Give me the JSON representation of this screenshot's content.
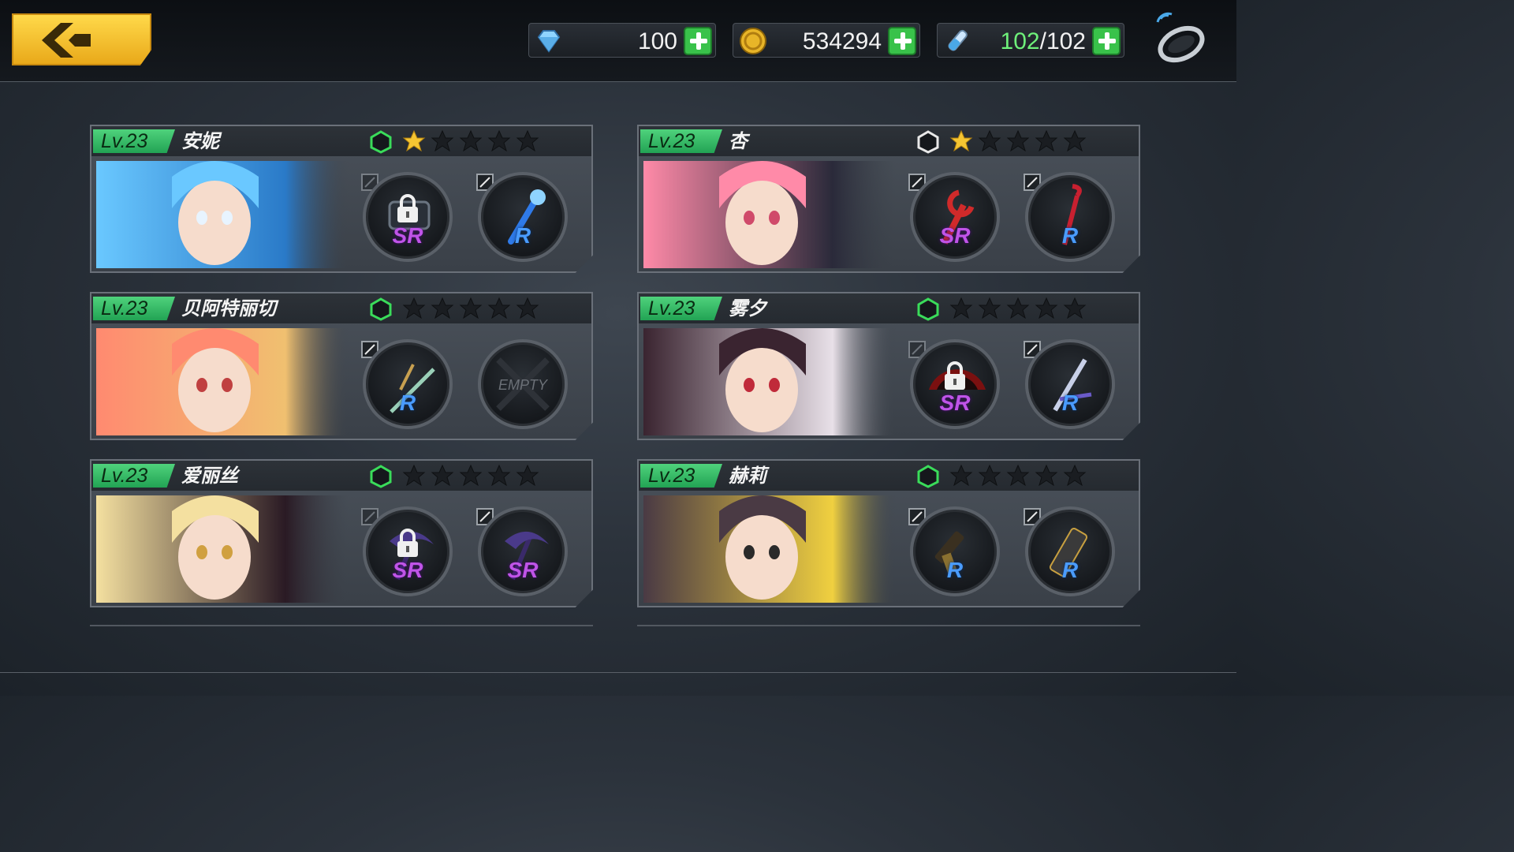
{
  "resources": {
    "gems": "100",
    "gold": "534294",
    "stamina_current": "102",
    "stamina_sep": "/",
    "stamina_max": "102"
  },
  "icons": {
    "back": "back-arrow-icon",
    "gem": "gem-icon",
    "gold": "gold-coin-icon",
    "stamina": "stamina-vial-icon",
    "settings": "settings-ring-icon"
  },
  "colors": {
    "level_badge": "#2fb862",
    "star_on": "#f5c532",
    "star_off": "#1a1d21",
    "rarity_sr": "#c054e8",
    "rarity_r": "#4a9cff",
    "plus_button": "#39c24a"
  },
  "characters": [
    {
      "level": "Lv.23",
      "name": "安妮",
      "stars": 1,
      "hex": "green",
      "slots": [
        {
          "rarity": "SR",
          "locked": true,
          "weapon": "chest-weapon-icon",
          "edit": false
        },
        {
          "rarity": "R",
          "locked": false,
          "weapon": "staff-weapon-icon",
          "edit": true
        }
      ]
    },
    {
      "level": "Lv.23",
      "name": "杏",
      "stars": 1,
      "hex": "white",
      "slots": [
        {
          "rarity": "SR",
          "locked": false,
          "weapon": "wrench-weapon-icon",
          "edit": true
        },
        {
          "rarity": "R",
          "locked": false,
          "weapon": "crowbar-weapon-icon",
          "edit": true
        }
      ]
    },
    {
      "level": "Lv.23",
      "name": "贝阿特丽切",
      "stars": 0,
      "hex": "green",
      "slots": [
        {
          "rarity": "R",
          "locked": false,
          "weapon": "rapier-weapon-icon",
          "edit": true
        },
        {
          "rarity": "",
          "empty": "EMPTY",
          "edit": false
        }
      ]
    },
    {
      "level": "Lv.23",
      "name": "雾夕",
      "stars": 0,
      "hex": "green",
      "slots": [
        {
          "rarity": "SR",
          "locked": true,
          "weapon": "fan-weapon-icon",
          "edit": false
        },
        {
          "rarity": "R",
          "locked": false,
          "weapon": "spear-weapon-icon",
          "edit": true
        }
      ]
    },
    {
      "level": "Lv.23",
      "name": "爱丽丝",
      "stars": 0,
      "hex": "green",
      "slots": [
        {
          "rarity": "SR",
          "locked": true,
          "weapon": "scythe-weapon-icon",
          "edit": false
        },
        {
          "rarity": "SR",
          "locked": false,
          "weapon": "scythe-weapon-icon",
          "edit": true
        }
      ]
    },
    {
      "level": "Lv.23",
      "name": "赫莉",
      "stars": 0,
      "hex": "green",
      "slots": [
        {
          "rarity": "R",
          "locked": false,
          "weapon": "gun-weapon-icon",
          "edit": true
        },
        {
          "rarity": "R",
          "locked": false,
          "weapon": "chainsaw-weapon-icon",
          "edit": true
        }
      ]
    }
  ]
}
